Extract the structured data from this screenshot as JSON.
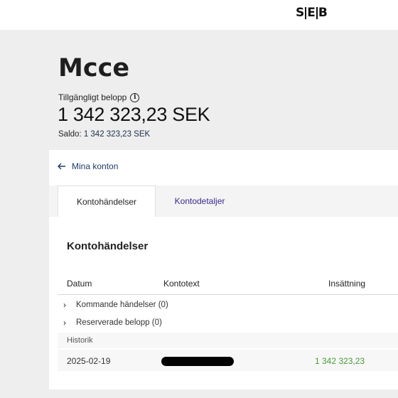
{
  "header": {
    "logo_left": "S",
    "logo_mid": "E",
    "logo_right": "B"
  },
  "account": {
    "name": "Mcce",
    "available_label": "Tillgängligt belopp",
    "available_amount": "1 342 323,23 SEK",
    "saldo_label": "Saldo: ",
    "saldo_value": "1 342 323,23 SEK"
  },
  "nav": {
    "back_label": "Mina konton"
  },
  "tabs": [
    {
      "label": "Kontohändelser",
      "active": true
    },
    {
      "label": "Kontodetaljer",
      "active": false
    }
  ],
  "transactions": {
    "title": "Kontohändelser",
    "columns": [
      "Datum",
      "Kontotext",
      "Insättning"
    ],
    "groups": [
      {
        "label": "Kommande händelser (0)"
      },
      {
        "label": "Reserverade belopp (0)"
      }
    ],
    "history_label": "Historik",
    "rows": [
      {
        "date": "2025-02-19",
        "deposit": "1 342 323,23"
      }
    ]
  },
  "colors": {
    "link": "#1f3b63",
    "tab_inactive": "#3a2a8a",
    "deposit": "#4a9a3a",
    "background": "#eeeeee"
  }
}
